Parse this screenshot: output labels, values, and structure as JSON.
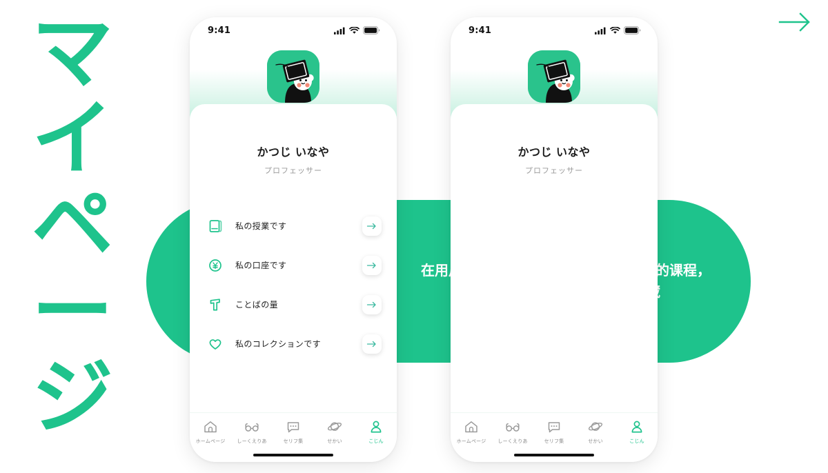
{
  "headline": {
    "chars": [
      "マ",
      "イ",
      "ペ",
      "ー",
      "ジ"
    ],
    "color": "#1EC38C"
  },
  "next_arrow": {
    "name": "next-arrow",
    "color": "#1EC38C"
  },
  "callout": {
    "line1": "在用户本人的个人主页可查看用户订阅的课程，",
    "line2": "个人账户， 词汇量， 个人收藏",
    "bg_color": "#1EC38C",
    "text_color": "#FFFFFF"
  },
  "phone": {
    "status": {
      "time": "9:41",
      "signal_icon": "cellular-signal-icon",
      "wifi_icon": "wifi-icon",
      "battery_icon": "battery-icon"
    },
    "profile": {
      "avatar_icon": "graduate-bear-avatar",
      "name": "かつじ いなや",
      "role": "プロフェッサー"
    },
    "menu": [
      {
        "icon": "book-icon",
        "label": "私の授業です",
        "go_icon": "arrow-right-icon"
      },
      {
        "icon": "yen-coin-icon",
        "label": "私の口座です",
        "go_icon": "arrow-right-icon"
      },
      {
        "icon": "text-t-icon",
        "label": "ことばの量",
        "go_icon": "arrow-right-icon"
      },
      {
        "icon": "heart-icon",
        "label": "私のコレクションです",
        "go_icon": "arrow-right-icon"
      }
    ],
    "tabs": [
      {
        "icon": "home-icon",
        "label": "ホームページ",
        "active": false
      },
      {
        "icon": "glasses-icon",
        "label": "しーくえりあ",
        "active": false
      },
      {
        "icon": "speech-bubble-icon",
        "label": "セリフ集",
        "active": false
      },
      {
        "icon": "planet-icon",
        "label": "せかい",
        "active": false
      },
      {
        "icon": "person-icon",
        "label": "こじん",
        "active": true
      }
    ],
    "accent_color": "#1EC38C"
  }
}
